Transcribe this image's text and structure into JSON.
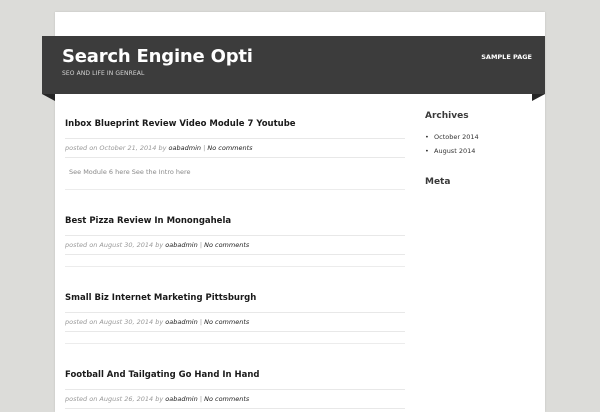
{
  "site": {
    "title": "Search Engine Opti",
    "description": "SEO AND LIFE IN GENREAL"
  },
  "nav": {
    "items": [
      {
        "label": "SAMPLE PAGE"
      }
    ]
  },
  "posts": [
    {
      "title": "Inbox Blueprint Review Video Module 7 Youtube",
      "meta_prefix": "posted on October 21, 2014 by",
      "author": "oabadmin",
      "separator": "|",
      "comments": "No comments",
      "excerpt": "See Module 6 here See the Intro here"
    },
    {
      "title": "Best Pizza Review In Monongahela",
      "meta_prefix": "posted on August 30, 2014 by",
      "author": "oabadmin",
      "separator": "|",
      "comments": "No comments",
      "excerpt": ""
    },
    {
      "title": "Small Biz Internet Marketing Pittsburgh",
      "meta_prefix": "posted on August 30, 2014 by",
      "author": "oabadmin",
      "separator": "|",
      "comments": "No comments",
      "excerpt": ""
    },
    {
      "title": "Football And Tailgating Go Hand In Hand",
      "meta_prefix": "posted on August 26, 2014 by",
      "author": "oabadmin",
      "separator": "|",
      "comments": "No comments",
      "excerpt": ""
    }
  ],
  "sidebar": {
    "archives": {
      "title": "Archives",
      "items": [
        {
          "bullet": "•",
          "label": "October 2014"
        },
        {
          "bullet": "•",
          "label": "August 2014"
        }
      ]
    },
    "meta": {
      "title": "Meta"
    }
  },
  "colors": {
    "background": "#dcdcd9",
    "header": "#3c3c3c",
    "header_fold": "#262626",
    "content": "#ffffff"
  }
}
